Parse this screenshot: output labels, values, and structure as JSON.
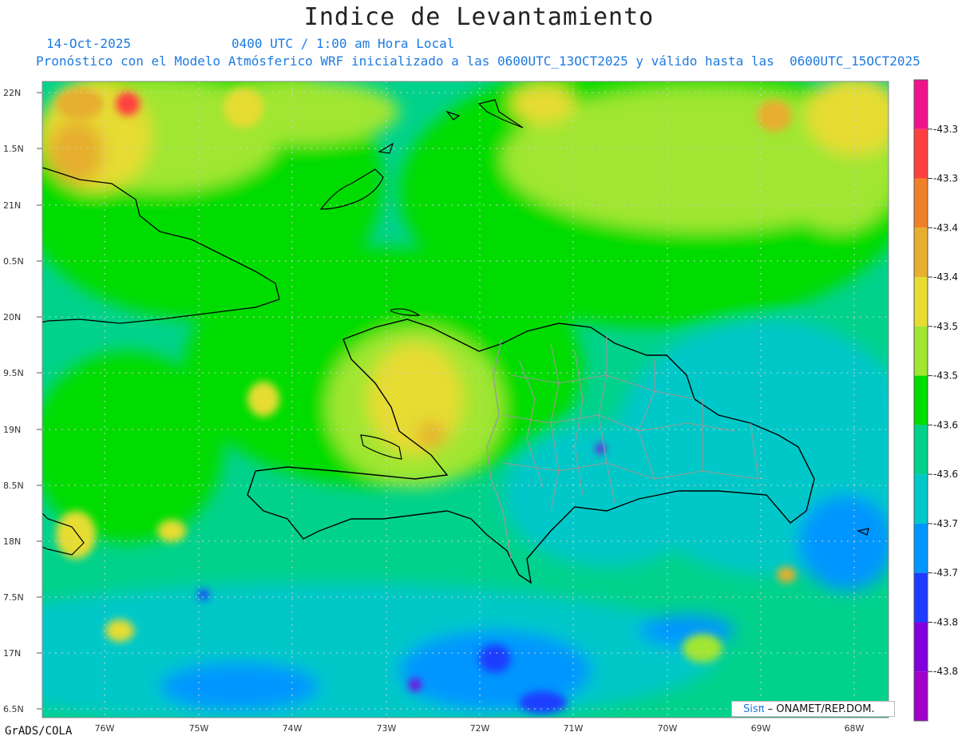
{
  "title": "Indice de Levantamiento",
  "date_label": "14-Oct-2025",
  "time_label": "0400 UTC / 1:00 am Hora Local",
  "model_description": "Pronóstico con el Modelo Atmósferico WRF inicializado a las 0600UTC_13OCT2025 y válido hasta las  0600UTC_15OCT2025",
  "footer_left": "GrADS/COLA",
  "credit": {
    "logo": "Sisπ",
    "text": " – ONAMET/REP.DOM."
  },
  "axes": {
    "lat_labels": [
      "22N",
      "1.5N",
      "21N",
      "0.5N",
      "20N",
      "9.5N",
      "19N",
      "8.5N",
      "18N",
      "7.5N",
      "17N",
      "6.5N"
    ],
    "lon_labels": [
      "76W",
      "75W",
      "74W",
      "73W",
      "72W",
      "71W",
      "70W",
      "69W",
      "68W"
    ]
  },
  "colorbar": {
    "labels": [
      "43.3",
      "43.3",
      "43.4",
      "43.4",
      "43.5",
      "43.5",
      "43.6",
      "43.6",
      "43.7",
      "43.7",
      "43.8",
      "43.8"
    ],
    "colors": [
      "#f0148c",
      "#ff4040",
      "#f08028",
      "#e6af2d",
      "#e6dc32",
      "#a0e632",
      "#00dc00",
      "#00d28c",
      "#00c8c8",
      "#0096ff",
      "#1e3cff",
      "#8200dc",
      "#a000c8"
    ]
  }
}
